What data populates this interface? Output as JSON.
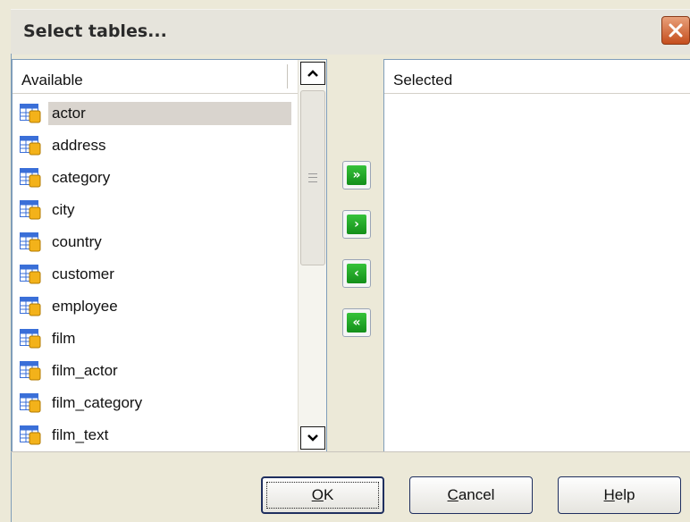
{
  "window": {
    "title": "Select tables..."
  },
  "available": {
    "header": "Available",
    "items": [
      {
        "label": "actor"
      },
      {
        "label": "address"
      },
      {
        "label": "category"
      },
      {
        "label": "city"
      },
      {
        "label": "country"
      },
      {
        "label": "customer"
      },
      {
        "label": "employee"
      },
      {
        "label": "film"
      },
      {
        "label": "film_actor"
      },
      {
        "label": "film_category"
      },
      {
        "label": "film_text"
      }
    ],
    "selected_item": "actor"
  },
  "selected": {
    "header": "Selected",
    "items": []
  },
  "move_buttons": [
    {
      "name": "move-all-right-button",
      "glyph": "»",
      "icon": "double-arrow-right-icon"
    },
    {
      "name": "move-right-button",
      "glyph": "›",
      "icon": "arrow-right-icon"
    },
    {
      "name": "move-left-button",
      "glyph": "‹",
      "icon": "arrow-left-icon"
    },
    {
      "name": "move-all-left-button",
      "glyph": "«",
      "icon": "double-arrow-left-icon"
    }
  ],
  "buttons": {
    "ok": {
      "mnemonic": "O",
      "rest": "K"
    },
    "cancel": {
      "mnemonic": "C",
      "rest": "ancel"
    },
    "help": {
      "mnemonic": "H",
      "rest": "elp"
    }
  },
  "colors": {
    "accent": "#1a9a22",
    "border": "#7f9db9",
    "selection": "#d9d4ce",
    "close": "#c54e1d"
  }
}
